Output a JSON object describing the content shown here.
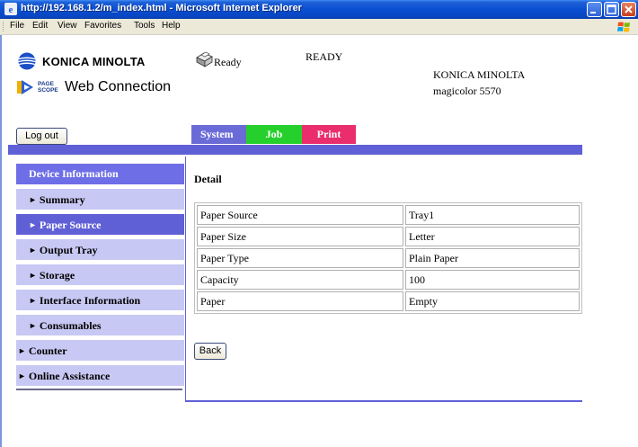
{
  "window": {
    "title": "http://192.168.1.2/m_index.html - Microsoft Internet Explorer",
    "menu": [
      "File",
      "Edit",
      "View",
      "Favorites",
      "Tools",
      "Help"
    ]
  },
  "header": {
    "brand_logo": "KONICA MINOLTA",
    "pagescope_small": "PAGE SCOPE",
    "pagescope_text": "Web Connection",
    "status_small": "Ready",
    "status_big": "READY",
    "device_brand": "KONICA MINOLTA",
    "device_model": "magicolor 5570",
    "logout_label": "Log out"
  },
  "tabs": {
    "system": "System",
    "job": "Job",
    "print": "Print",
    "active": "System"
  },
  "sidebar": {
    "section": "Device Information",
    "sub_items": [
      "Summary",
      "Paper Source",
      "Output Tray",
      "Storage",
      "Interface Information",
      "Consumables"
    ],
    "active": "Paper Source",
    "top_items": [
      "Counter",
      "Online Assistance"
    ]
  },
  "main": {
    "title": "Detail",
    "rows": [
      {
        "label": "Paper Source",
        "value": "Tray1"
      },
      {
        "label": "Paper Size",
        "value": "Letter"
      },
      {
        "label": "Paper Type",
        "value": "Plain Paper"
      },
      {
        "label": "Capacity",
        "value": "100"
      },
      {
        "label": "Paper",
        "value": "Empty"
      }
    ],
    "back_label": "Back"
  },
  "colors": {
    "system_tab": "#6b6bd8",
    "job_tab": "#26d02c",
    "print_tab": "#ea2d6c",
    "band": "#6060d6",
    "sidebar_light": "#c8c8f4",
    "sidebar_active": "#6060d6"
  }
}
